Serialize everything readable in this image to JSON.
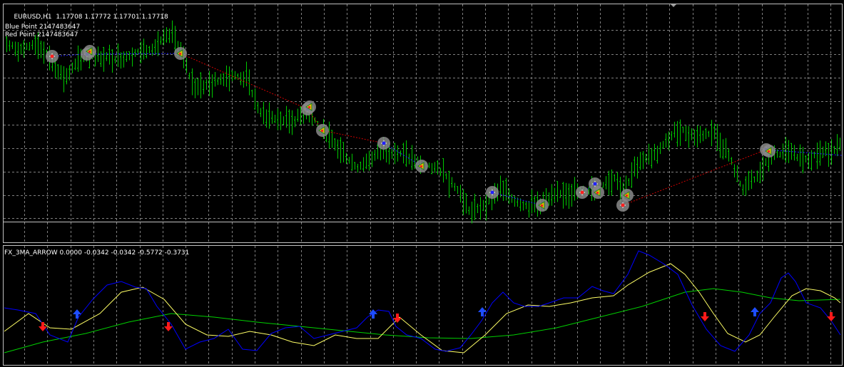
{
  "main_pane": {
    "symbol_label": "EURUSD,H1",
    "ohlc": "1.17708 1.17772 1.17701 1.17718",
    "blue_point_label": "Blue Point 2147483647",
    "red_point_label": "Red Point 2147483647"
  },
  "indicator_pane": {
    "label": "FX_3MA_ARROW 0.0000 -0.0342 -0.0342 -0.5772 -0.3731"
  },
  "colors": {
    "background": "#000000",
    "grid": "#7f7f7f",
    "bars": "#00c800",
    "ma_fast": "#0000ff",
    "ma_mid": "#ffff66",
    "ma_slow": "#00d000",
    "zigzag_red": "#d00000",
    "zigzag_blue": "#2020ff",
    "arrow_up": "#1e4dff",
    "arrow_down": "#ff1a1a",
    "marker_ring": "#8a8a8a"
  },
  "icons": {
    "up_arrow": "blue-up-arrow-icon",
    "down_arrow": "red-down-arrow-icon",
    "point_marker": "zigzag-point-marker-icon"
  }
}
